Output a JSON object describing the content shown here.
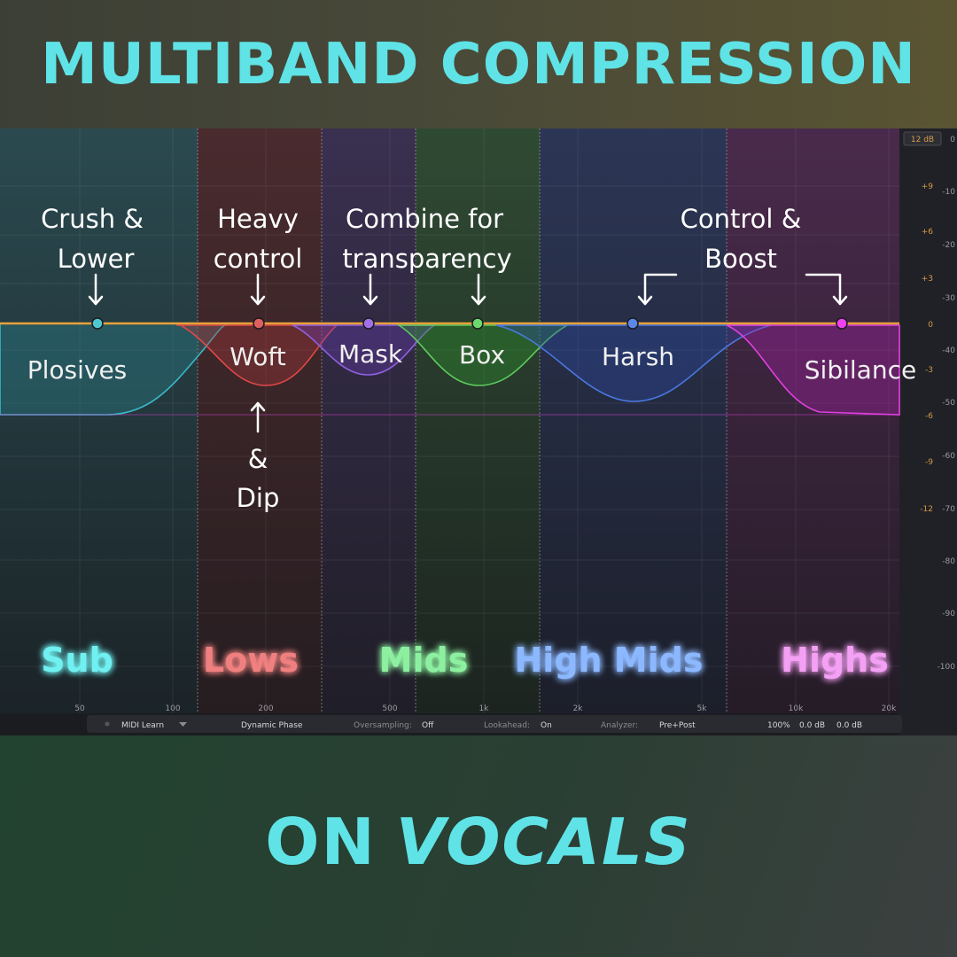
{
  "titles": {
    "top": "MULTIBAND COMPRESSION",
    "bottom_upright": "ON",
    "bottom_italic": "VOCALS"
  },
  "colors": {
    "title": "#5fe3e6",
    "sub": "#4fc8d4",
    "lows": "#e06060",
    "mids_purple": "#9060e0",
    "mids_green": "#5ecb5e",
    "highmids": "#4a78e0",
    "highs": "#e040e0",
    "threshold_line": "#e8a23a"
  },
  "bands": [
    {
      "label": "Sub",
      "color": "#4fd8d8"
    },
    {
      "label": "Lows",
      "color": "#f07a7a"
    },
    {
      "label": "Mids",
      "color": "#7ef09a"
    },
    {
      "label": "High Mids",
      "color": "#7fb0ff"
    },
    {
      "label": "Highs",
      "color": "#f08cf0"
    }
  ],
  "annotations": {
    "crush": [
      "Crush &",
      "Lower"
    ],
    "heavy": [
      "Heavy",
      "control"
    ],
    "combine": [
      "Combine  for",
      "transparency"
    ],
    "control": [
      "Control &",
      "Boost"
    ],
    "dip": [
      "&",
      "Dip"
    ]
  },
  "problems": [
    "Plosives",
    "Woft",
    "Mask",
    "Box",
    "Harsh",
    "Sibilance"
  ],
  "freq_ticks": [
    "50",
    "100",
    "200",
    "500",
    "1k",
    "2k",
    "5k",
    "10k",
    "20k"
  ],
  "db_range_label": "12 dB",
  "db_ticks_left": [
    "+9",
    "+6",
    "+3",
    "0",
    "-3",
    "-6",
    "-9",
    "-12"
  ],
  "db_ticks_right": [
    "0",
    "-10",
    "-20",
    "-30",
    "-40",
    "-50",
    "-60",
    "-70",
    "-80",
    "-90",
    "-100"
  ],
  "status_bar": {
    "midi_learn": "MIDI Learn",
    "dynamic_phase": "Dynamic Phase",
    "oversampling_label": "Oversampling:",
    "oversampling_value": "Off",
    "lookahead_label": "Lookahead:",
    "lookahead_value": "On",
    "analyzer_label": "Analyzer:",
    "analyzer_value": "Pre+Post",
    "zoom": "100%",
    "gain_a": "0.0 dB",
    "gain_b": "0.0 dB"
  }
}
